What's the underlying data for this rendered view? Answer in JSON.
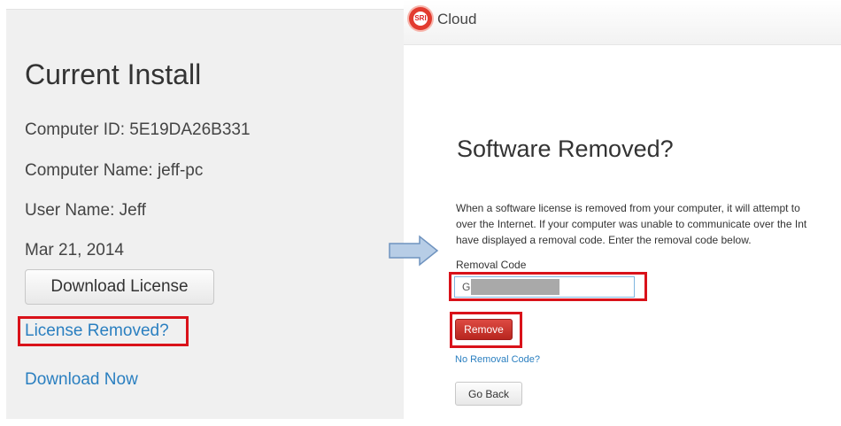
{
  "left": {
    "title": "Current Install",
    "computer_id": "Computer ID: 5E19DA26B331",
    "computer_name": "Computer Name: jeff-pc",
    "user_name": "User Name: Jeff",
    "date": "Mar 21, 2014",
    "download_license_label": "Download License",
    "license_removed_label": "License Removed?",
    "download_now_label": "Download Now"
  },
  "right": {
    "brand": {
      "logo_text": "SRI",
      "name": "Cloud"
    },
    "title": "Software Removed?",
    "description": [
      "When a software license is removed from your computer, it will attempt to",
      "over the Internet. If your computer was unable to communicate over the Int",
      "have displayed a removal code. Enter the removal code below."
    ],
    "removal_code_label": "Removal Code",
    "removal_code_value": "GM",
    "remove_label": "Remove",
    "no_removal_code_label": "No Removal Code?",
    "go_back_label": "Go Back"
  },
  "colors": {
    "highlight": "#d9121a",
    "link": "#2a7fc0",
    "arrow_fill": "#b7cde6",
    "arrow_stroke": "#6f93bf"
  },
  "icons": {
    "arrow": "right-arrow-icon",
    "logo": "sri-logo-icon"
  }
}
